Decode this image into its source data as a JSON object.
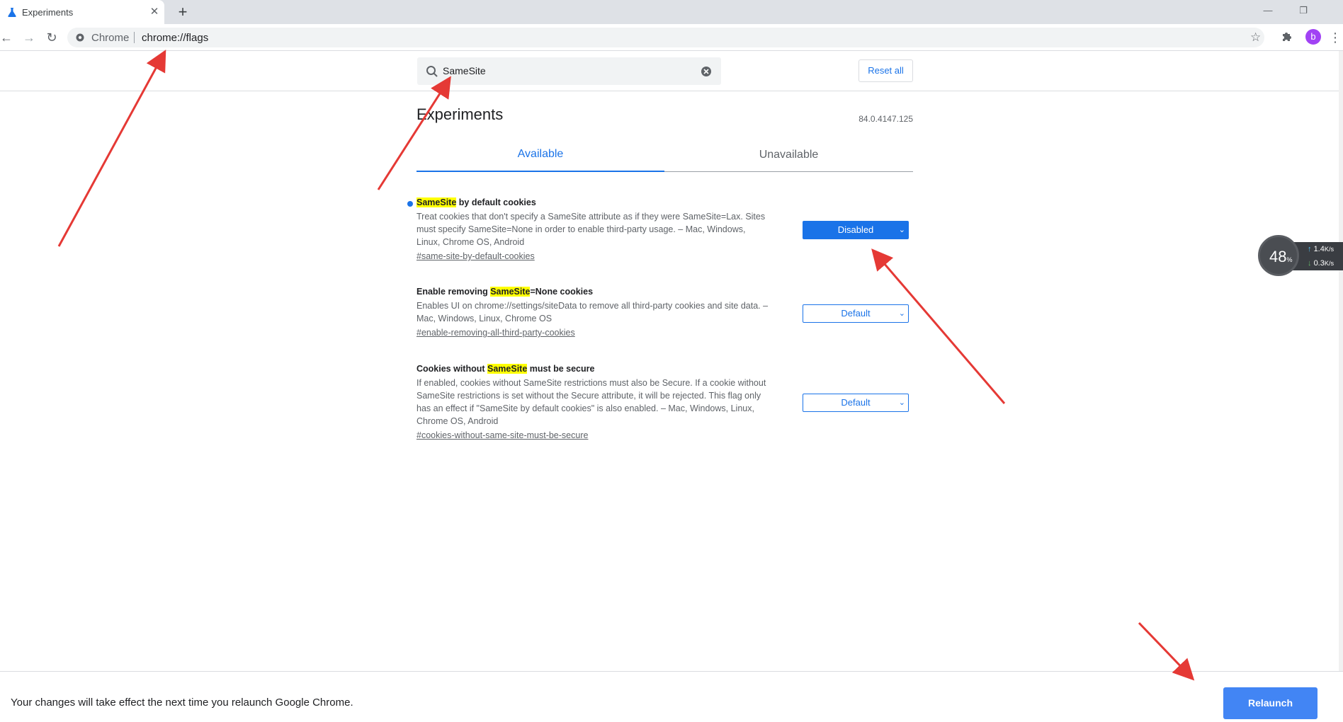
{
  "browser": {
    "tab_title": "Experiments",
    "new_tab_label": "+",
    "omnibox_chrome_label": "Chrome",
    "omnibox_url": "chrome://flags",
    "avatar_initial": "b"
  },
  "header": {
    "search_value": "SameSite",
    "reset_label": "Reset all"
  },
  "content": {
    "title": "Experiments",
    "version": "84.0.4147.125",
    "tabs": [
      "Available",
      "Unavailable"
    ]
  },
  "flags": [
    {
      "title_before": "",
      "title_hl": "SameSite",
      "title_after": " by default cookies",
      "description": "Treat cookies that don't specify a SameSite attribute as if they were SameSite=Lax. Sites must specify SameSite=None in order to enable third-party usage. – Mac, Windows, Linux, Chrome OS, Android",
      "link": "#same-site-by-default-cookies",
      "select_value": "Disabled"
    },
    {
      "title_before": "Enable removing ",
      "title_hl": "SameSite",
      "title_after": "=None cookies",
      "description": "Enables UI on chrome://settings/siteData to remove all third-party cookies and site data. – Mac, Windows, Linux, Chrome OS",
      "link": "#enable-removing-all-third-party-cookies",
      "select_value": "Default"
    },
    {
      "title_before": "Cookies without ",
      "title_hl": "SameSite",
      "title_after": " must be secure",
      "description": "If enabled, cookies without SameSite restrictions must also be Secure. If a cookie without SameSite restrictions is set without the Secure attribute, it will be rejected. This flag only has an effect if \"SameSite by default cookies\" is also enabled. – Mac, Windows, Linux, Chrome OS, Android",
      "link": "#cookies-without-same-site-must-be-secure",
      "select_value": "Default"
    }
  ],
  "bottom": {
    "message": "Your changes will take effect the next time you relaunch Google Chrome.",
    "relaunch_label": "Relaunch"
  },
  "net_widget": {
    "percent": "48",
    "percent_unit": "%",
    "upload": "1.4",
    "download": "0.3",
    "rate_unit": "K/s"
  },
  "colors": {
    "accent": "#1a73e8",
    "highlight": "#ffff00",
    "relaunch": "#4285f4",
    "annotation_arrow": "#e53935"
  }
}
